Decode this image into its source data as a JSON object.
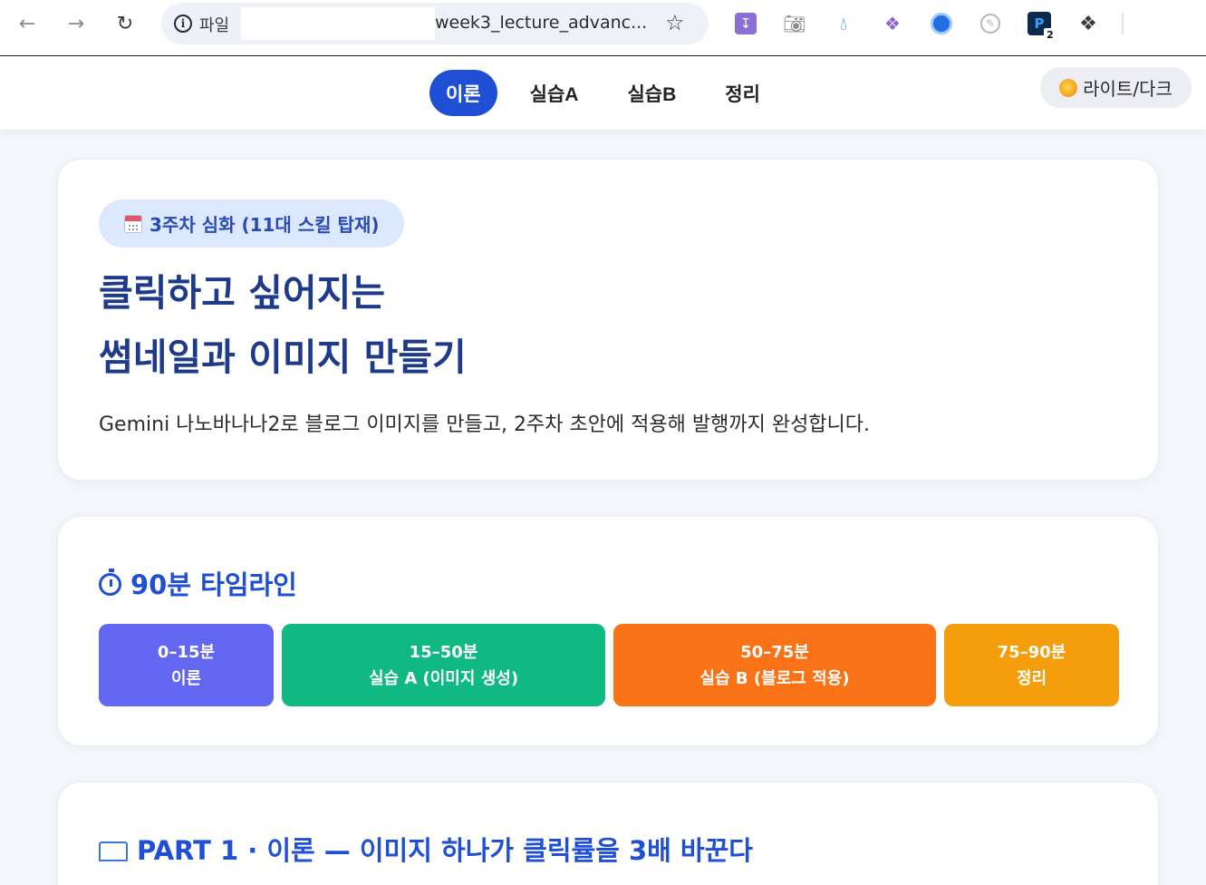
{
  "browser": {
    "scheme_label": "파일",
    "url_text": "week3_lecture_advanc...",
    "icons": {
      "back": "arrow-left-icon",
      "forward": "arrow-right-icon",
      "reload": "reload-icon",
      "site_info": "info-icon",
      "bookmark": "star-icon",
      "extensions": [
        "download-extension-icon",
        "camera-extension-icon",
        "water-drop-extension-icon",
        "crystal-extension-icon",
        "globe-extension-icon",
        "compass-extension-icon",
        "p-extension-icon",
        "puzzle-extensions-icon"
      ]
    },
    "extension_badge": "2"
  },
  "header": {
    "tabs": [
      {
        "label": "이론",
        "active": true
      },
      {
        "label": "실습A",
        "active": false
      },
      {
        "label": "실습B",
        "active": false
      },
      {
        "label": "정리",
        "active": false
      }
    ],
    "theme_toggle": {
      "label": "라이트/다크",
      "icon": "sun-icon"
    }
  },
  "hero": {
    "badge": "3주차 심화 (11대 스킬 탑재)",
    "badge_icon": "calendar-icon",
    "title_line1": "클릭하고 싶어지는",
    "title_line2": "썸네일과 이미지 만들기",
    "description": "Gemini 나노바나나2로 블로그 이미지를 만들고, 2주차 초안에 적용해 발행까지 완성합니다."
  },
  "timeline": {
    "title": "90분 타임라인",
    "title_icon": "stopwatch-icon",
    "segments": [
      {
        "time": "0–15분",
        "label": "이론",
        "color": "#6366f1"
      },
      {
        "time": "15–50분",
        "label": "실습 A (이미지 생성)",
        "color": "#10b981"
      },
      {
        "time": "50–75분",
        "label": "실습 B (블로그 적용)",
        "color": "#f97316"
      },
      {
        "time": "75–90분",
        "label": "정리",
        "color": "#f59e0b"
      }
    ]
  },
  "part1": {
    "title": "PART 1 · 이론 — 이미지 하나가 클릭률을 3배 바꾼다",
    "title_icon": "open-book-icon"
  },
  "colors": {
    "accent": "#1f4fd4",
    "heading": "#1e3a8a",
    "badge_bg": "#dbe8fd",
    "page_bg": "#f4f6fb"
  }
}
